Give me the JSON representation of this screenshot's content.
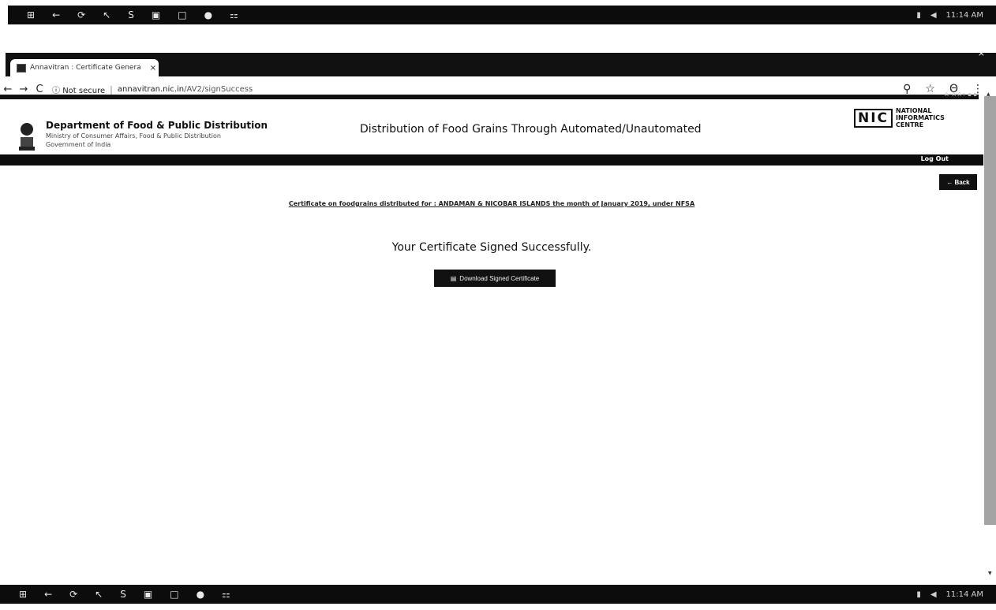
{
  "taskbar": {
    "icons": [
      "start-icon",
      "back-icon",
      "refresh-icon",
      "pointer-icon",
      "s-icon",
      "window-icon",
      "square-icon",
      "browser-icon",
      "apps-icon"
    ],
    "time": "11:14 AM"
  },
  "browser": {
    "tab_title": "Annavitran : Certificate Genera",
    "tab_close": "×",
    "window_close": "×",
    "security_label": "Not secure",
    "url_host": "annavitran.nic.in",
    "url_path": "/AV2/signSuccess"
  },
  "header": {
    "dept_title": "Department of Food & Public Distribution",
    "dept_ministry": "Ministry of Consumer Affairs, Food & Public Distribution",
    "dept_gov": "Government of India",
    "center_title": "Distribution of Food Grains Through Automated/Unautomated",
    "nic_mark": "NIC",
    "nic_line1": "NATIONAL",
    "nic_line2": "INFORMATICS",
    "nic_line3": "CENTRE",
    "logout_label": "Log Out"
  },
  "page": {
    "back_label": "Back",
    "certificate_line": "Certificate on foodgrains distributed for : ANDAMAN & NICOBAR ISLANDS the month of January 2019, under NFSA",
    "success_message": "Your Certificate Signed Successfully.",
    "download_label": "Download Signed Certificate"
  }
}
